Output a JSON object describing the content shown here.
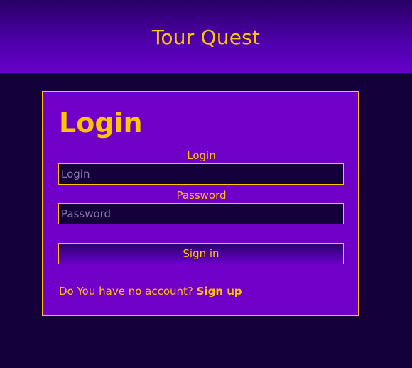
{
  "header": {
    "title": "Tour Quest"
  },
  "login_form": {
    "heading": "Login",
    "login_label": "Login",
    "login_placeholder": "Login",
    "login_value": "",
    "password_label": "Password",
    "password_placeholder": "Password",
    "password_value": "",
    "submit_label": "Sign in",
    "signup_prompt": "Do You have no account?",
    "signup_link_label": "Sign up"
  },
  "colors": {
    "page_background": "#14003a",
    "card_background": "#7000c9",
    "accent": "#ffc400",
    "header_gradient_top": "#2a0066",
    "header_gradient_bottom": "#6600c8"
  }
}
